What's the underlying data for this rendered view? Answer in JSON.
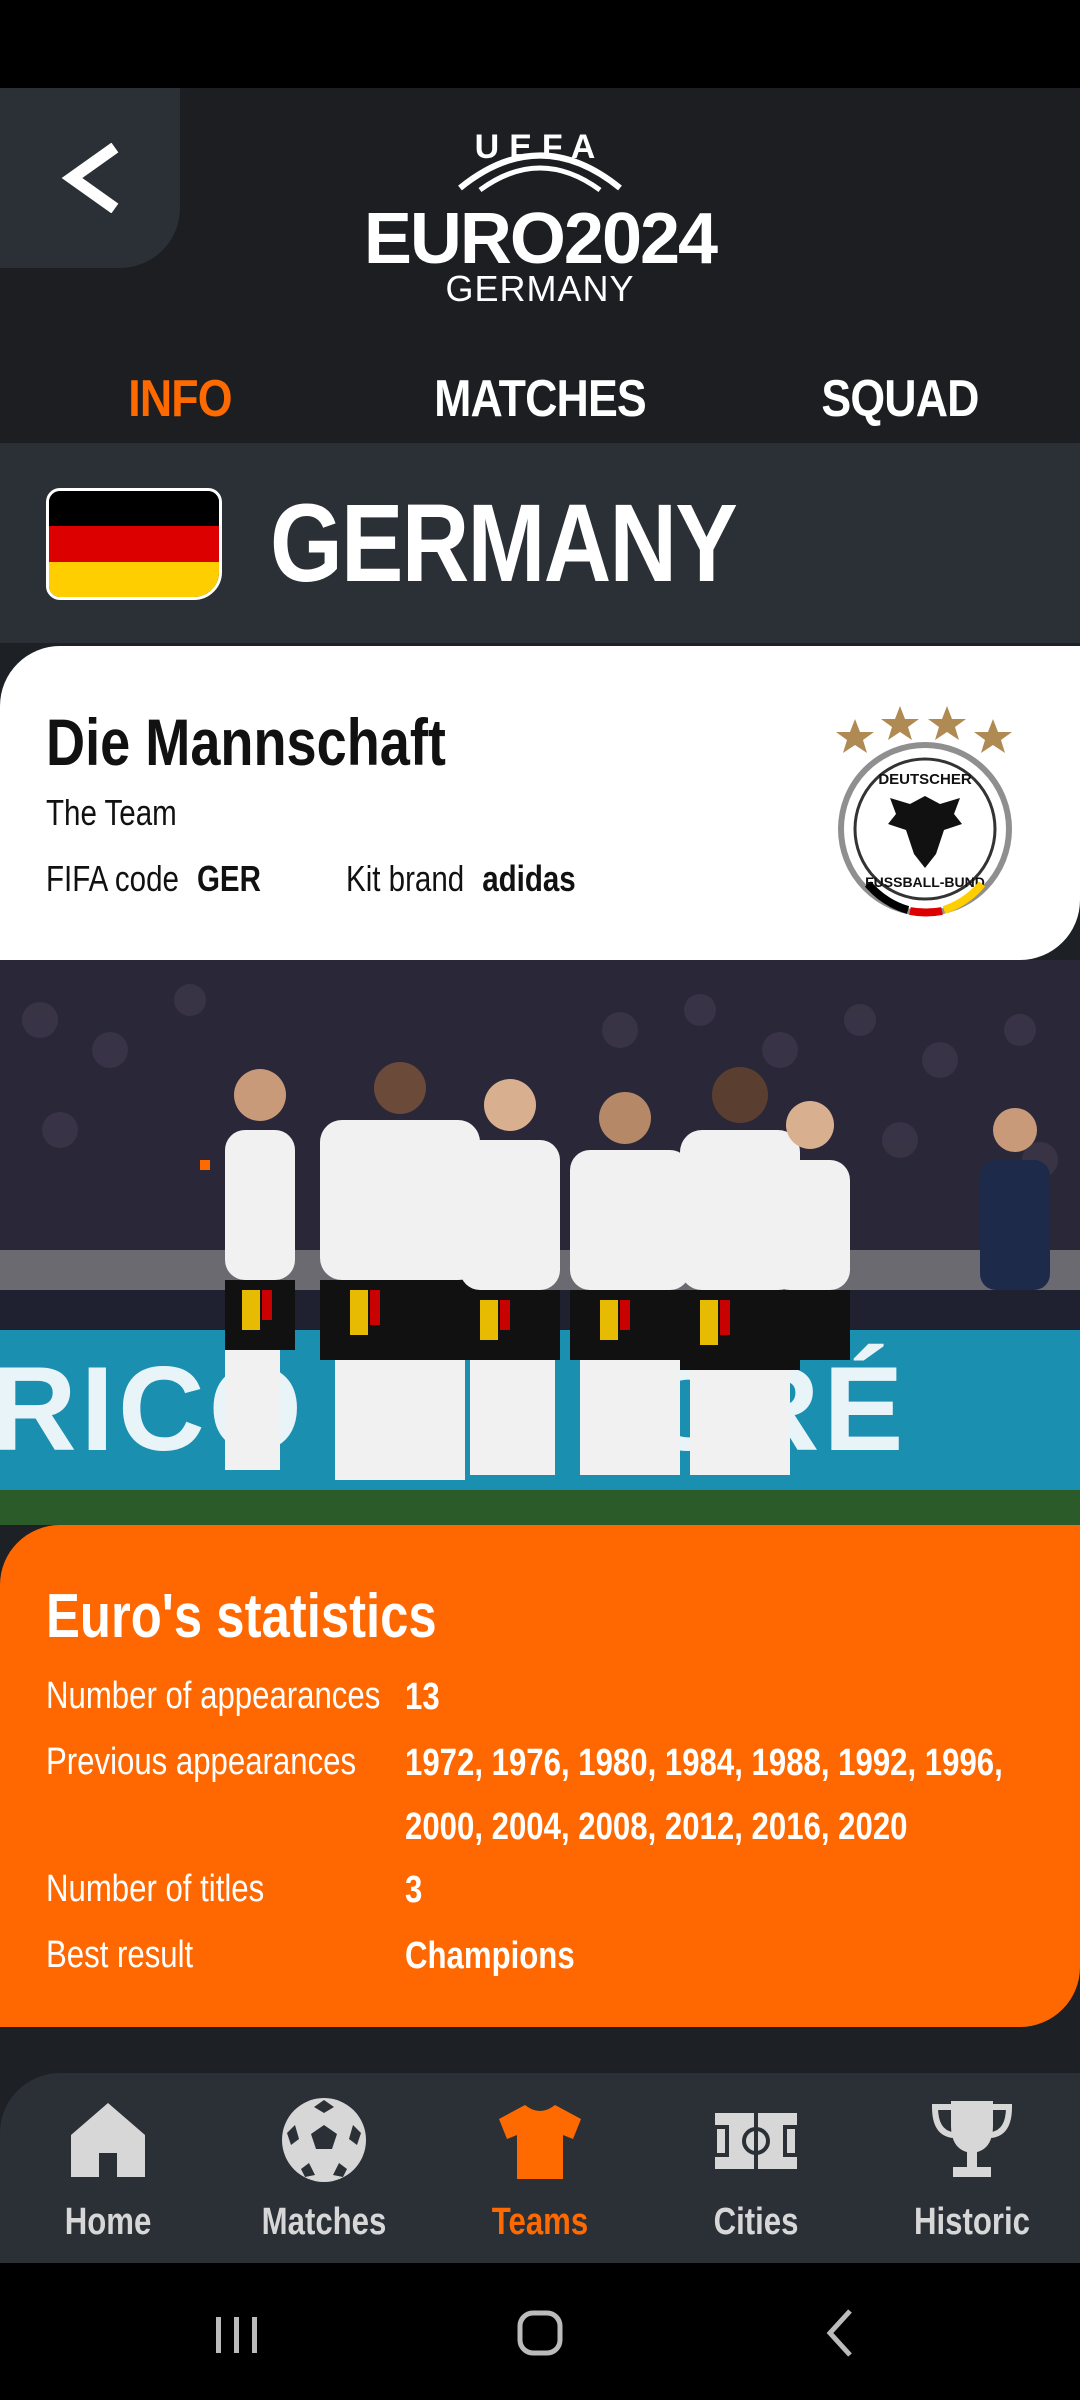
{
  "header": {
    "logo": {
      "top": "UEFA",
      "title": "EURO2024",
      "host": "GERMANY"
    },
    "tabs": [
      {
        "label": "INFO",
        "active": true
      },
      {
        "label": "MATCHES",
        "active": false
      },
      {
        "label": "SQUAD",
        "active": false
      }
    ]
  },
  "team": {
    "name": "GERMANY",
    "nickname": "Die Mannschaft",
    "nickname_translation": "The Team",
    "fifa_code_label": "FIFA code",
    "fifa_code": "GER",
    "kit_brand_label": "Kit brand",
    "kit_brand": "adidas",
    "crest": {
      "top_text": "DEUTSCHER",
      "bottom_text": "FUSSBALL-BUND",
      "stars": 4
    },
    "photo_banner_text": "RICO         CRÉ"
  },
  "stats": {
    "title": "Euro's statistics",
    "rows": [
      {
        "label": "Number of appearances",
        "value": "13"
      },
      {
        "label": "Previous appearances",
        "value": "1972, 1976, 1980, 1984, 1988, 1992, 1996, 2000, 2004, 2008, 2012, 2016, 2020"
      },
      {
        "label": "Number of titles",
        "value": "3"
      },
      {
        "label": "Best result",
        "value": "Champions"
      }
    ]
  },
  "nav": [
    {
      "label": "Home",
      "icon": "home-icon",
      "active": false
    },
    {
      "label": "Matches",
      "icon": "soccer-ball-icon",
      "active": false
    },
    {
      "label": "Teams",
      "icon": "jersey-icon",
      "active": true
    },
    {
      "label": "Cities",
      "icon": "stadium-pitch-icon",
      "active": false
    },
    {
      "label": "Historic",
      "icon": "trophy-icon",
      "active": false
    }
  ],
  "colors": {
    "accent": "#ff6a00",
    "stats_bg": "#ff6800",
    "header_bg": "#1c1e21",
    "panel_bg": "#2b3036",
    "flag": [
      "#000000",
      "#dd0000",
      "#ffce00"
    ]
  }
}
